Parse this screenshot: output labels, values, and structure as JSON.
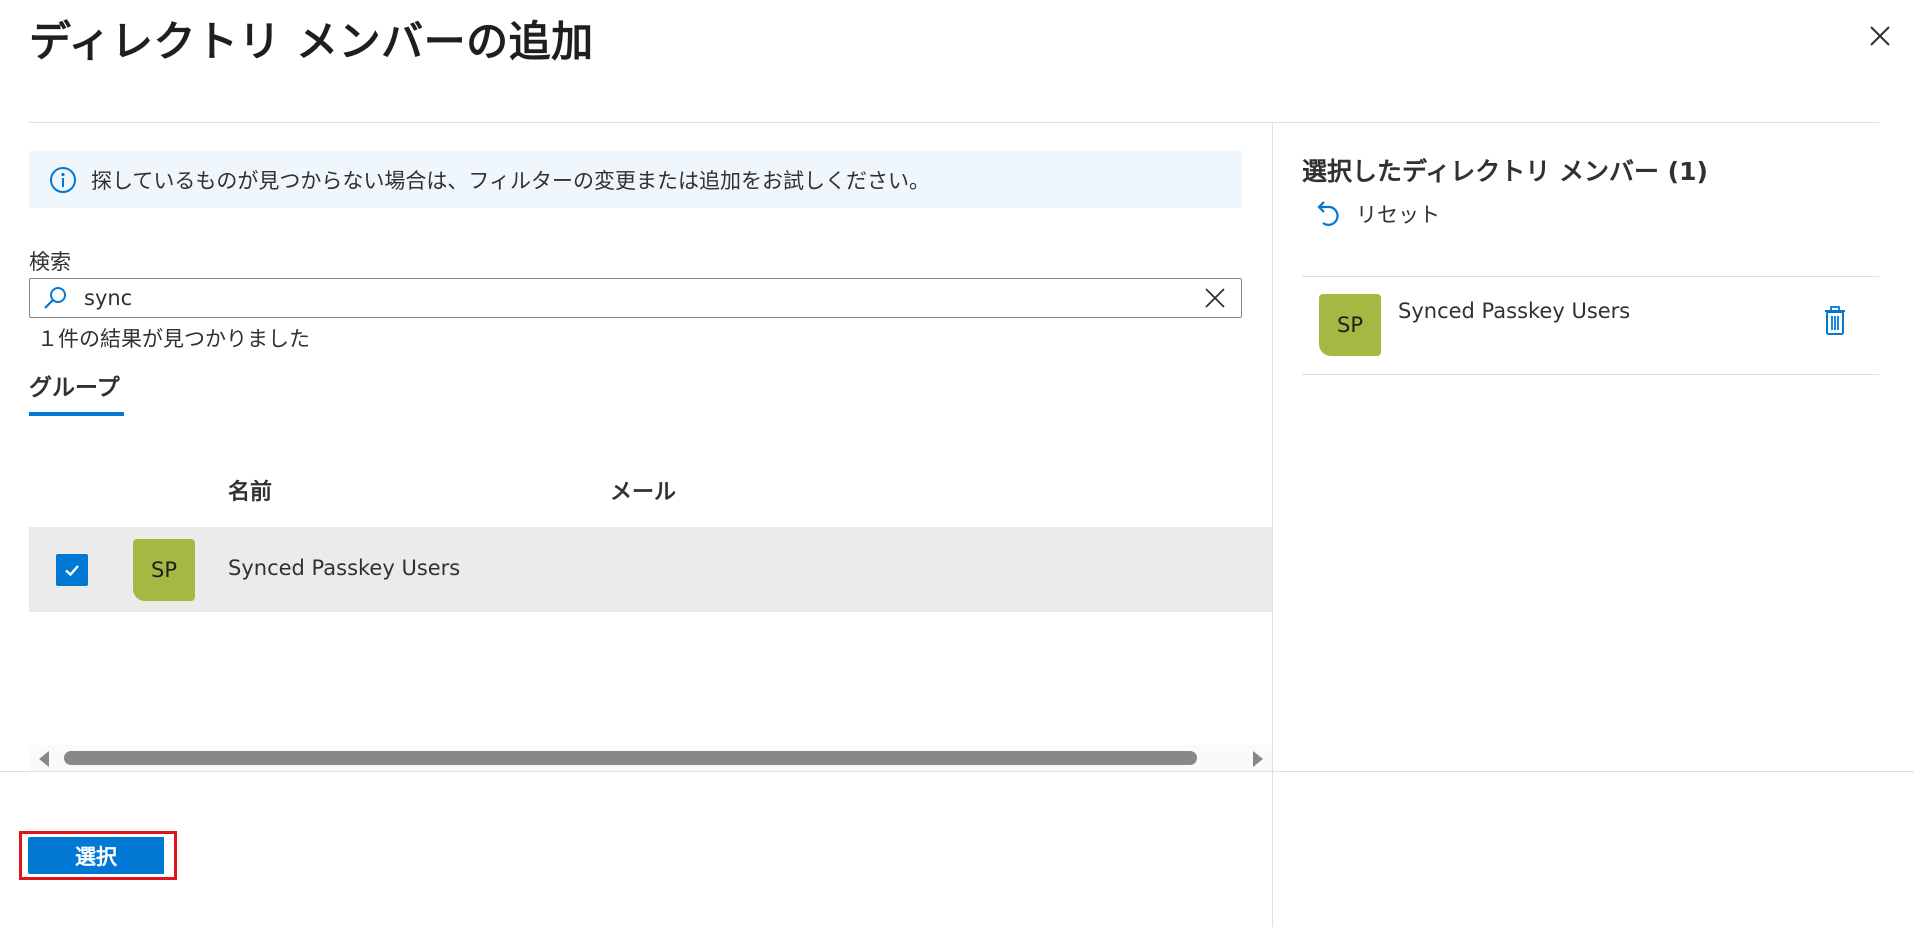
{
  "dialog": {
    "title": "ディレクトリ メンバーの追加"
  },
  "info": {
    "message": "探しているものが見つからない場合は、フィルターの変更または追加をお試しください。"
  },
  "search": {
    "label": "検索",
    "value": "sync",
    "result_count": "１件の結果が見つかりました"
  },
  "tabs": [
    {
      "label": "グループ",
      "active": true
    }
  ],
  "table": {
    "columns": [
      "名前",
      "メール"
    ],
    "rows": [
      {
        "initials": "SP",
        "name": "Synced Passkey Users",
        "mail": "",
        "selected": true
      }
    ]
  },
  "selected_panel": {
    "title": "選択したディレクトリ メンバー (1)",
    "reset_label": "リセット",
    "items": [
      {
        "initials": "SP",
        "name": "Synced Passkey Users"
      }
    ]
  },
  "footer": {
    "select_label": "選択"
  },
  "colors": {
    "accent": "#0078d4",
    "avatar": "#a4b944",
    "highlight_border": "#e3131c",
    "info_bg": "#eff6fc",
    "row_selected_bg": "#edebe9"
  },
  "icons": {
    "close": "close-icon",
    "info": "info-icon",
    "search": "search-icon",
    "clear": "clear-icon",
    "checkbox": "checkmark-icon",
    "reset": "undo-icon",
    "delete": "trash-icon",
    "scroll_left": "scroll-left-arrow-icon",
    "scroll_right": "scroll-right-arrow-icon"
  }
}
